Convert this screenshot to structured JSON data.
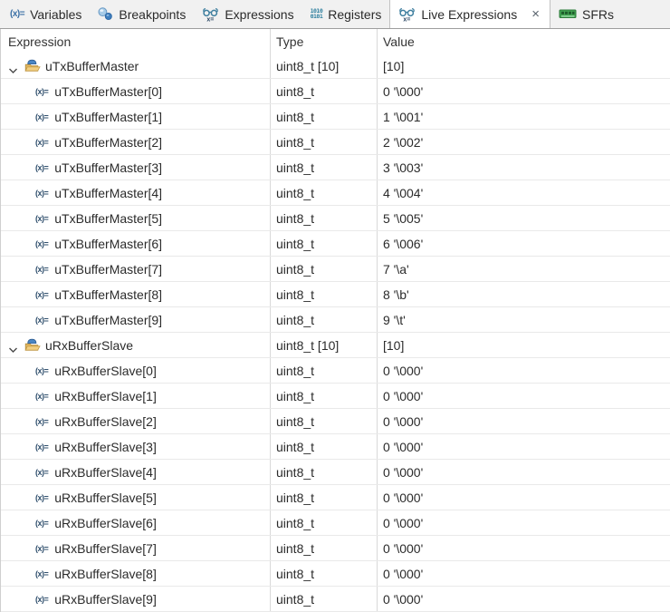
{
  "view": {
    "title": "Live Expressions",
    "close_symbol": "×"
  },
  "tabs": [
    {
      "label": "Variables",
      "icon": "variables-icon",
      "active": false,
      "closable": false
    },
    {
      "label": "Breakpoints",
      "icon": "breakpoints-icon",
      "active": false,
      "closable": false
    },
    {
      "label": "Expressions",
      "icon": "expressions-icon",
      "active": false,
      "closable": false
    },
    {
      "label": "Registers",
      "icon": "registers-icon",
      "active": false,
      "closable": false
    },
    {
      "label": "Live Expressions",
      "icon": "live-expressions-icon",
      "active": true,
      "closable": true
    },
    {
      "label": "SFRs",
      "icon": "sfrs-icon",
      "active": false,
      "closable": false
    }
  ],
  "table": {
    "columns": [
      "Expression",
      "Type",
      "Value"
    ],
    "rows": [
      {
        "kind": "parent",
        "expanded": true,
        "name": "uTxBufferMaster",
        "type": "uint8_t [10]",
        "value": "[10]"
      },
      {
        "kind": "child",
        "name": "uTxBufferMaster[0]",
        "type": "uint8_t",
        "value": "0 '\\000'"
      },
      {
        "kind": "child",
        "name": "uTxBufferMaster[1]",
        "type": "uint8_t",
        "value": "1 '\\001'"
      },
      {
        "kind": "child",
        "name": "uTxBufferMaster[2]",
        "type": "uint8_t",
        "value": "2 '\\002'"
      },
      {
        "kind": "child",
        "name": "uTxBufferMaster[3]",
        "type": "uint8_t",
        "value": "3 '\\003'"
      },
      {
        "kind": "child",
        "name": "uTxBufferMaster[4]",
        "type": "uint8_t",
        "value": "4 '\\004'"
      },
      {
        "kind": "child",
        "name": "uTxBufferMaster[5]",
        "type": "uint8_t",
        "value": "5 '\\005'"
      },
      {
        "kind": "child",
        "name": "uTxBufferMaster[6]",
        "type": "uint8_t",
        "value": "6 '\\006'"
      },
      {
        "kind": "child",
        "name": "uTxBufferMaster[7]",
        "type": "uint8_t",
        "value": "7 '\\a'"
      },
      {
        "kind": "child",
        "name": "uTxBufferMaster[8]",
        "type": "uint8_t",
        "value": "8 '\\b'"
      },
      {
        "kind": "child",
        "name": "uTxBufferMaster[9]",
        "type": "uint8_t",
        "value": "9 '\\t'"
      },
      {
        "kind": "parent",
        "expanded": true,
        "name": "uRxBufferSlave",
        "type": "uint8_t [10]",
        "value": "[10]"
      },
      {
        "kind": "child",
        "name": "uRxBufferSlave[0]",
        "type": "uint8_t",
        "value": "0 '\\000'"
      },
      {
        "kind": "child",
        "name": "uRxBufferSlave[1]",
        "type": "uint8_t",
        "value": "0 '\\000'"
      },
      {
        "kind": "child",
        "name": "uRxBufferSlave[2]",
        "type": "uint8_t",
        "value": "0 '\\000'"
      },
      {
        "kind": "child",
        "name": "uRxBufferSlave[3]",
        "type": "uint8_t",
        "value": "0 '\\000'"
      },
      {
        "kind": "child",
        "name": "uRxBufferSlave[4]",
        "type": "uint8_t",
        "value": "0 '\\000'"
      },
      {
        "kind": "child",
        "name": "uRxBufferSlave[5]",
        "type": "uint8_t",
        "value": "0 '\\000'"
      },
      {
        "kind": "child",
        "name": "uRxBufferSlave[6]",
        "type": "uint8_t",
        "value": "0 '\\000'"
      },
      {
        "kind": "child",
        "name": "uRxBufferSlave[7]",
        "type": "uint8_t",
        "value": "0 '\\000'"
      },
      {
        "kind": "child",
        "name": "uRxBufferSlave[8]",
        "type": "uint8_t",
        "value": "0 '\\000'"
      },
      {
        "kind": "child",
        "name": "uRxBufferSlave[9]",
        "type": "uint8_t",
        "value": "0 '\\000'"
      }
    ]
  },
  "icon_text": {
    "variables_glyph": "(x)=",
    "registers_line1": "1010",
    "registers_line2": "0101",
    "tree_variable_glyph": "(x)="
  },
  "colors": {
    "tabbar_bg": "#f1f1f1",
    "active_tab_bg": "#ffffff",
    "tabbar_border": "#9e9e9e",
    "grid_line_vertical": "#d9d9d9",
    "grid_line_horizontal": "#e9e9e9",
    "text": "#2b2b2b",
    "icon_teal": "#3f7f9f",
    "icon_navy": "#31506e",
    "icon_blue": "#3a6fa5",
    "breakpoint_light_blue": "#a8cce8",
    "breakpoint_dark_blue": "#3f7fbe",
    "folder_yellow": "#f2cf82",
    "folder_blue": "#4a86c4",
    "sfr_green": "#41a351"
  }
}
